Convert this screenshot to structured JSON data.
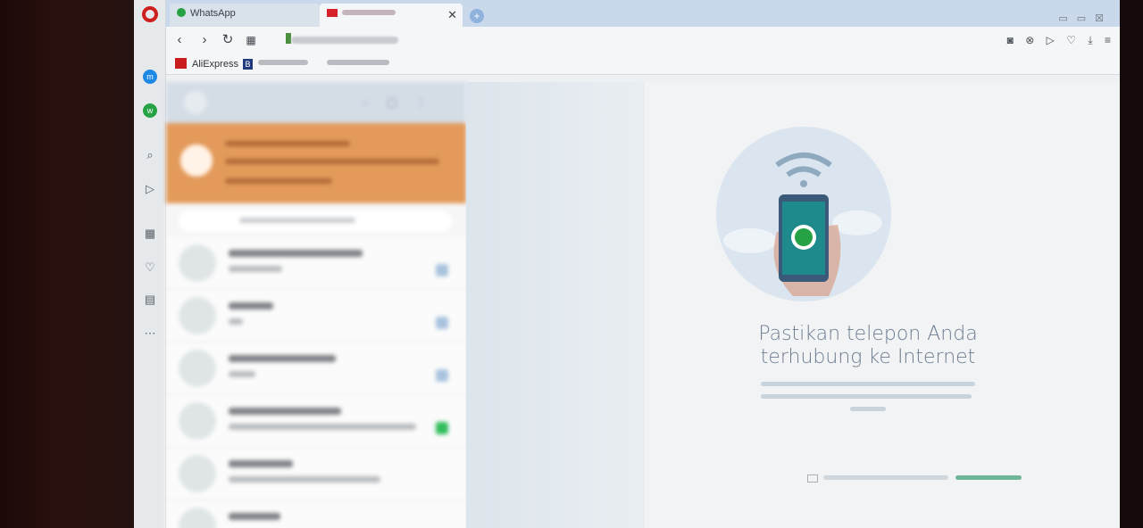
{
  "browser": {
    "tabs": [
      {
        "label": "WhatsApp"
      },
      {
        "label": ""
      }
    ],
    "new_tab_label": "+",
    "close_tab_glyph": "✕",
    "nav": {
      "back": "‹",
      "forward": "›",
      "reload": "↻",
      "speed_dial": "▦"
    },
    "bookmarks": [
      {
        "label": "AliExpress",
        "icon": "aliexpress-icon",
        "color": "#c91d1d"
      },
      {
        "label": "B",
        "icon": "booking-icon",
        "color": "#213a7c"
      }
    ],
    "toolbar_icons": [
      "camera-icon",
      "adblock-icon",
      "flow-icon",
      "heart-icon",
      "download-icon",
      "menu-icon"
    ],
    "toolbar_glyphs": [
      "◙",
      "⊗",
      "▷",
      "♡",
      "⤓",
      "≡"
    ]
  },
  "sidebar": {
    "items": [
      {
        "name": "messenger",
        "glyph": "m"
      },
      {
        "name": "whatsapp",
        "glyph": "w"
      },
      {
        "name": "search",
        "glyph": "⌕"
      },
      {
        "name": "flow",
        "glyph": "▷"
      },
      {
        "name": "speed-dial",
        "glyph": "▦"
      },
      {
        "name": "bookmarks",
        "glyph": "♡"
      },
      {
        "name": "history",
        "glyph": "▤"
      },
      {
        "name": "extensions",
        "glyph": "⋯"
      }
    ]
  },
  "whatsapp": {
    "intro": {
      "title": "Pastikan telepon Anda terhubung ke Internet"
    },
    "colors": {
      "alert": "#e39a5a",
      "brand": "#25a244",
      "header": "#d4dce6"
    }
  }
}
